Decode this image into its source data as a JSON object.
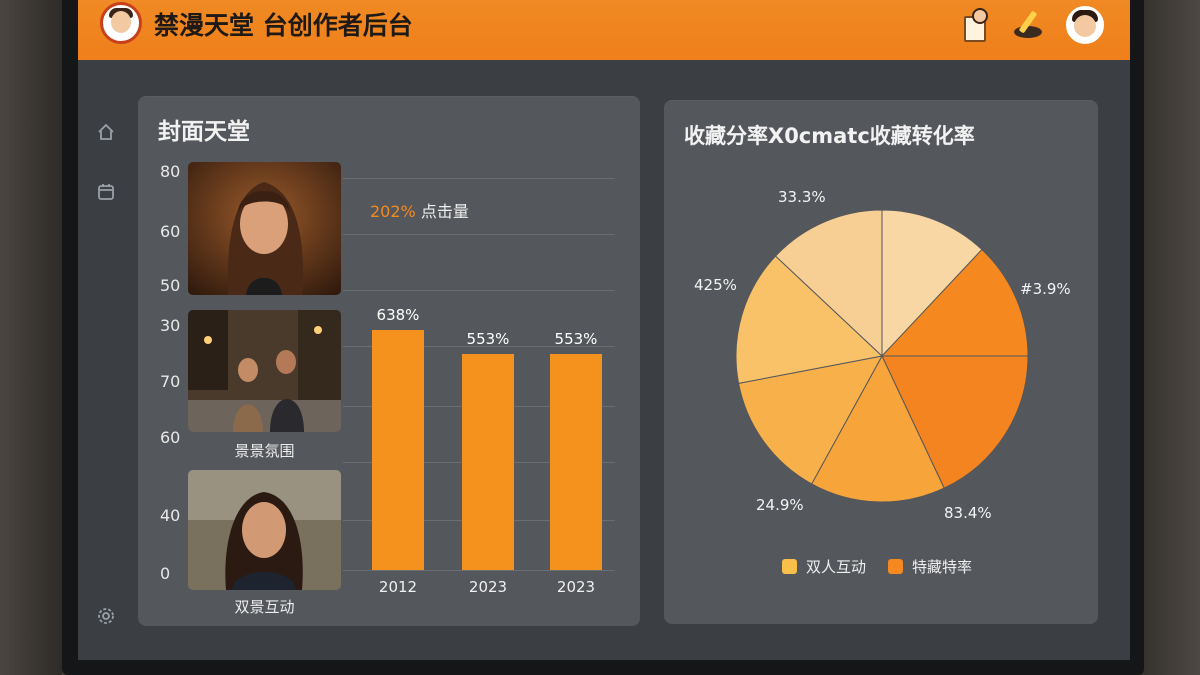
{
  "app": {
    "title": "禁漫天堂 台创作者后台"
  },
  "header_icons": [
    "document-person-icon",
    "tool-icon",
    "user-avatar-icon"
  ],
  "sidebar": {
    "icons": [
      "home-icon",
      "calendar-icon",
      "settings-icon"
    ]
  },
  "bar_card": {
    "title": "封面天堂",
    "legend_pct": "202%",
    "legend_text": "点击量",
    "y_ticks": [
      "80",
      "60",
      "50",
      "30",
      "70",
      "60",
      "40",
      "0"
    ],
    "thumbnails": [
      {
        "label": "",
        "icon": "portrait-photo"
      },
      {
        "label": "景景氛围",
        "icon": "couple-street-photo"
      },
      {
        "label": "双景互动",
        "icon": "portrait-photo"
      }
    ]
  },
  "pie_card": {
    "title": "收藏分率X0cmatc收藏转化率",
    "slice_labels": [
      "33.3%",
      "#3.9%",
      "83.4%",
      "24.9%",
      "425%"
    ],
    "legend": [
      {
        "name": "双人互动",
        "color": "#f8bf4a"
      },
      {
        "name": "特藏特率",
        "color": "#f5891f"
      }
    ]
  },
  "chart_data": [
    {
      "type": "bar",
      "title": "封面天堂",
      "categories": [
        "2012",
        "2023",
        "2023"
      ],
      "values": [
        63.8,
        55.3,
        55.3
      ],
      "data_labels": [
        "638%",
        "553%",
        "553%"
      ],
      "series": [
        {
          "name": "点击量",
          "values": [
            63.8,
            55.3,
            55.3
          ]
        }
      ],
      "legend_annotation": "202%",
      "y_tick_labels": [
        "80",
        "60",
        "50",
        "30",
        "70",
        "60",
        "40",
        "0"
      ],
      "grid": true,
      "color": "#f5921e"
    },
    {
      "type": "pie",
      "title": "收藏分率X0cmatc收藏转化率",
      "slices": [
        {
          "label": "33.3%",
          "value": 12,
          "color": "#f8d7a4"
        },
        {
          "label": "#3.9%",
          "value": 13,
          "color": "#f5891f"
        },
        {
          "label": "83.4%",
          "value": 18,
          "color": "#f4841f"
        },
        {
          "label": "24.9%",
          "value": 15,
          "color": "#f7a43a"
        },
        {
          "label": "",
          "value": 14,
          "color": "#f8b04a"
        },
        {
          "label": "425%",
          "value": 15,
          "color": "#f9c269"
        },
        {
          "label": "",
          "value": 13,
          "color": "#f7cf95"
        }
      ],
      "legend": [
        "双人互动",
        "特藏特率"
      ],
      "legend_position": "bottom"
    }
  ]
}
